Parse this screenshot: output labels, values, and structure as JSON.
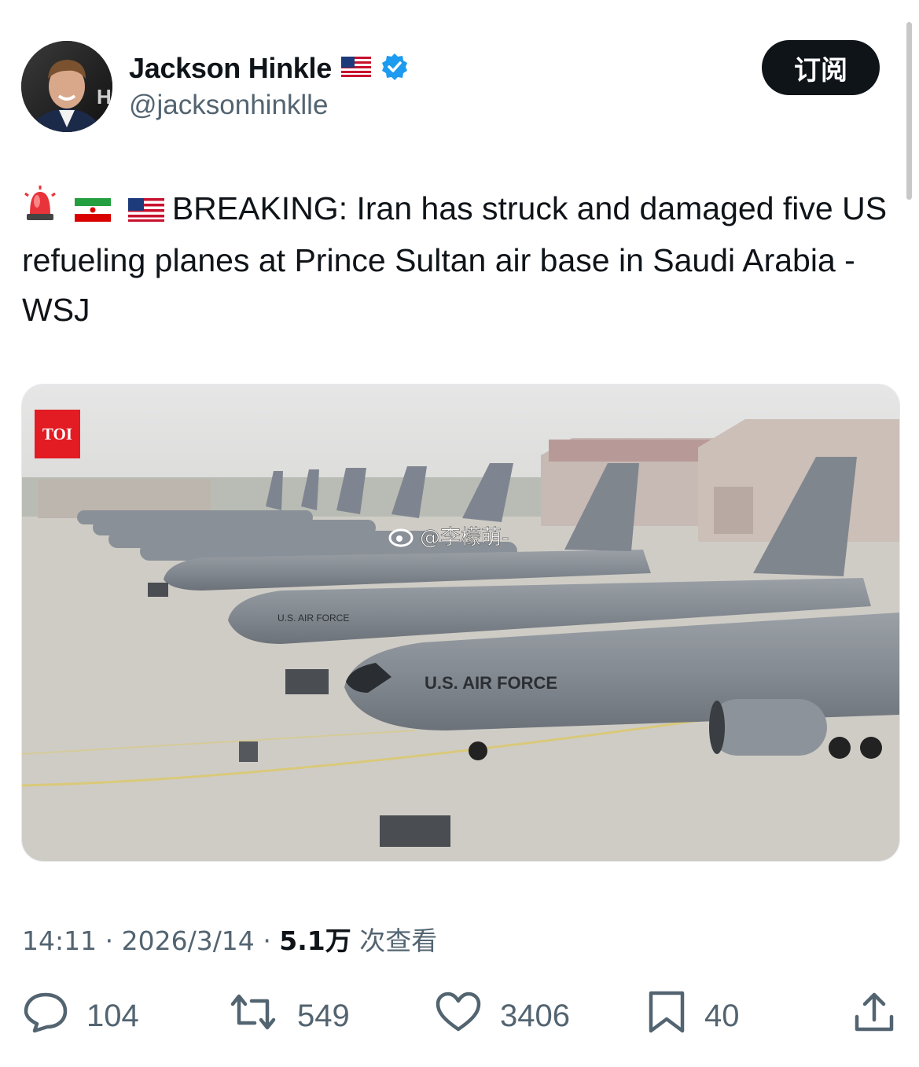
{
  "author": {
    "name": "Jackson Hinkle",
    "handle": "@jacksonhinklle",
    "avatar_letters": "HB"
  },
  "subscribe_label": "订阅",
  "tweet": {
    "text": "BREAKING: Iran has struck and damaged five US refueling planes at Prince Sultan air base in Saudi Arabia - WSJ"
  },
  "media": {
    "source_badge": "TOI",
    "watermark": "@李檬萌-",
    "aircraft_marking": "U.S. AIR FORCE"
  },
  "meta": {
    "time": "14:11",
    "date": "2026/3/14",
    "views": "5.1万",
    "views_label": "次查看"
  },
  "actions": {
    "replies": "104",
    "reposts": "549",
    "likes": "3406",
    "bookmarks": "40"
  },
  "colors": {
    "verified": "#1d9bf0",
    "text": "#0f1419",
    "secondary": "#536471",
    "subscribe_bg": "#0f1419"
  }
}
